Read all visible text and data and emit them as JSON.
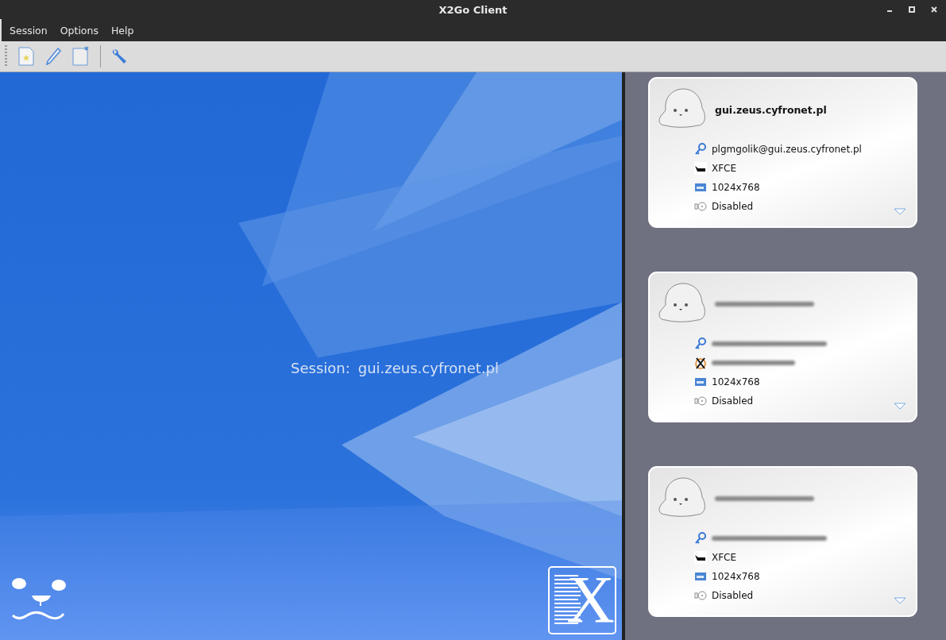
{
  "window": {
    "title": "X2Go Client"
  },
  "menu": [
    "Session",
    "Options",
    "Help"
  ],
  "toolbar": [
    {
      "kind": "new"
    },
    {
      "kind": "edit"
    },
    {
      "kind": "delete"
    },
    {
      "kind": "settings"
    }
  ],
  "session_label": "Session:",
  "session_value": "gui.zeus.cyfronet.pl",
  "logo_letter": "X",
  "sessions": [
    {
      "name": "gui.zeus.cyfronet.pl",
      "rows": [
        {
          "kind": "user",
          "text": "plgmgolik@gui.zeus.cyfronet.pl"
        },
        {
          "kind": "xfce",
          "text": "XFCE"
        },
        {
          "kind": "resolution",
          "text": "1024x768"
        },
        {
          "kind": "sound",
          "text": "Disabled"
        }
      ]
    },
    {
      "name_redacted": true,
      "rows": [
        {
          "kind": "user",
          "redacted": true
        },
        {
          "kind": "xsession",
          "redacted": true
        },
        {
          "kind": "resolution",
          "text": "1024x768"
        },
        {
          "kind": "sound",
          "text": "Disabled"
        }
      ]
    },
    {
      "name_redacted": true,
      "rows": [
        {
          "kind": "user",
          "redacted": true
        },
        {
          "kind": "xfce",
          "text": "XFCE"
        },
        {
          "kind": "resolution",
          "text": "1024x768"
        },
        {
          "kind": "sound",
          "text": "Disabled"
        }
      ]
    }
  ]
}
